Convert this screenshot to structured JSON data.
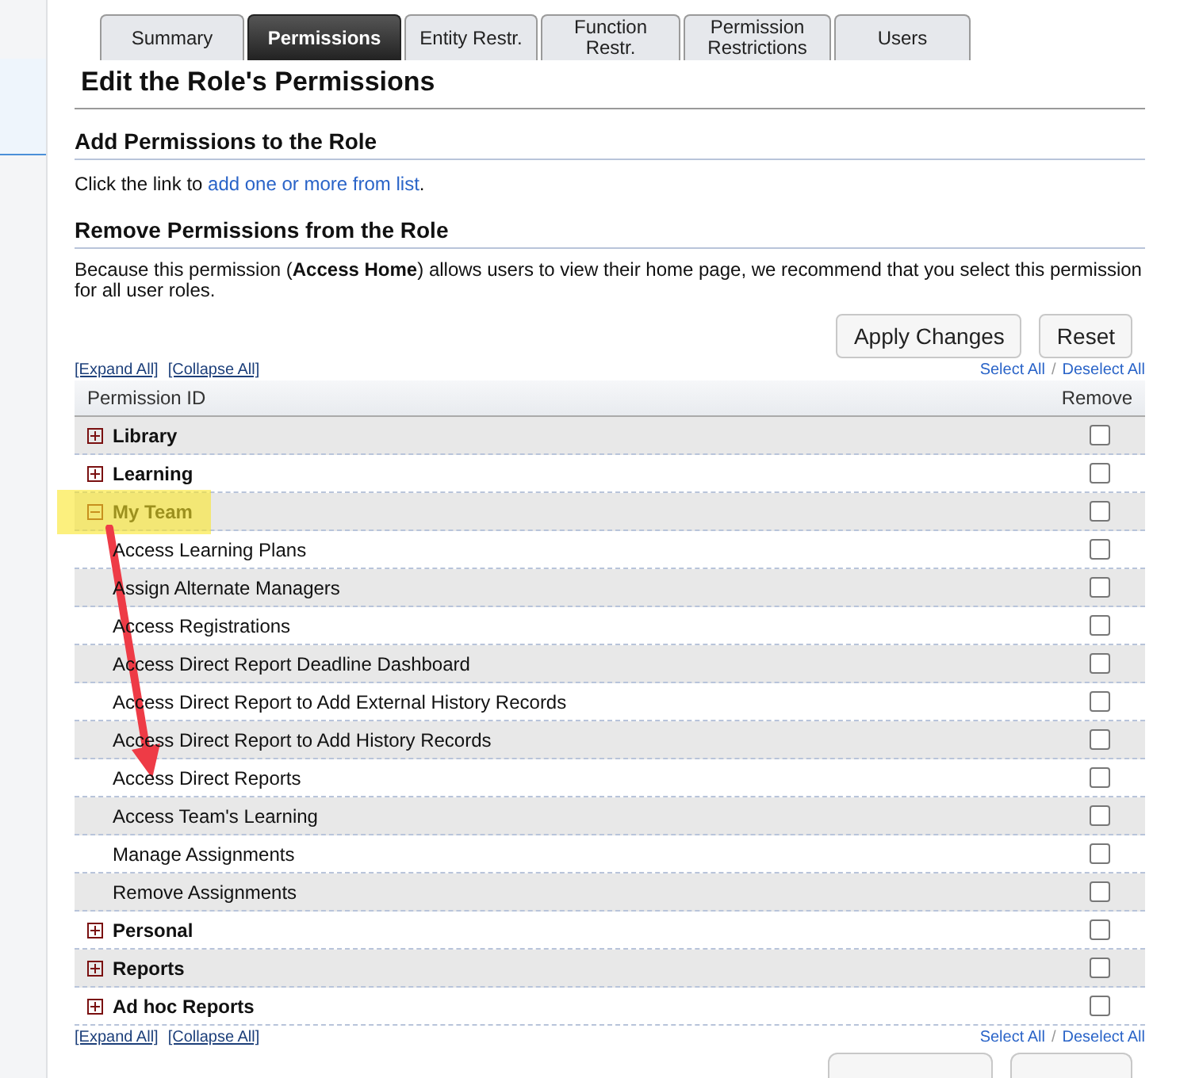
{
  "tabs": [
    {
      "label": "Summary",
      "selected": false
    },
    {
      "label": "Permissions",
      "selected": true
    },
    {
      "label": "Entity Restr.",
      "selected": false
    },
    {
      "label": "Function Restr.",
      "selected": false
    },
    {
      "label": "Permission Restrictions",
      "selected": false
    },
    {
      "label": "Users",
      "selected": false
    }
  ],
  "title": "Edit the Role's Permissions",
  "add_section": {
    "heading": "Add Permissions to the Role",
    "text": "Click the link to ",
    "link": "add one or more from list",
    "after": "."
  },
  "remove_section": {
    "heading": "Remove Permissions from the Role",
    "note": "Because this permission (**Access Home**) allows users to view their home page, we recommend that you select this permission for all user roles."
  },
  "buttons": [
    "Apply Changes",
    "Reset"
  ],
  "link_rows": [
    {
      "expand_all": "[Expand All]",
      "collapse_all": "[Collapse All]",
      "select_all": "Select All",
      "separator": "/",
      "deselect_all": "Deselect All"
    },
    {
      "expand_all": "[Expand All]",
      "collapse_all": "[Collapse All]",
      "select_all": "Select All",
      "separator": "/",
      "deselect_all": "Deselect All"
    }
  ],
  "table": {
    "columns": [
      "Permission ID",
      "Remove"
    ],
    "groups": [
      {
        "name": "Library",
        "expanded": false,
        "checked": false
      },
      {
        "name": "Learning",
        "expanded": false,
        "checked": false
      },
      {
        "name": "My Team",
        "expanded": true,
        "checked": false,
        "highlighted": true,
        "children": [
          {
            "name": "Access Learning Plans",
            "checked": false
          },
          {
            "name": "Assign Alternate Managers",
            "checked": false
          },
          {
            "name": "Access Registrations",
            "checked": false
          },
          {
            "name": "Access Direct Report Deadline Dashboard",
            "checked": false
          },
          {
            "name": "Access Direct Report to Add External History Records",
            "checked": false
          },
          {
            "name": "Access Direct Report to Add History Records",
            "checked": false
          },
          {
            "name": "Access Direct Reports",
            "checked": false,
            "arrow_target": true
          },
          {
            "name": "Access Team's Learning",
            "checked": false
          },
          {
            "name": "Manage Assignments",
            "checked": false
          },
          {
            "name": "Remove Assignments",
            "checked": false
          }
        ]
      },
      {
        "name": "Personal",
        "expanded": false,
        "checked": false
      },
      {
        "name": "Reports",
        "expanded": false,
        "checked": false
      },
      {
        "name": "Ad hoc Reports",
        "expanded": false,
        "checked": false
      }
    ]
  }
}
